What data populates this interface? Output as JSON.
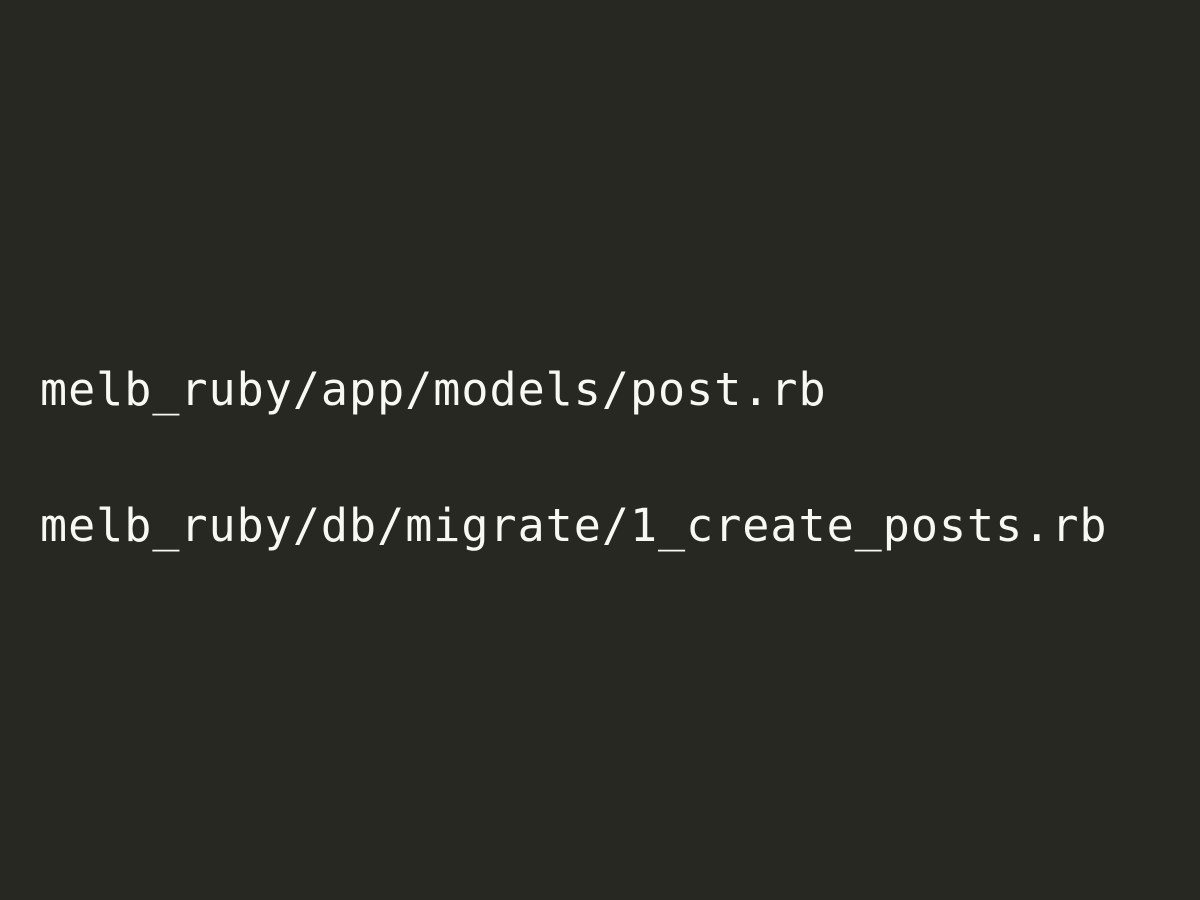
{
  "slide": {
    "background_color": "#272822",
    "text_color": "#f8f8f2",
    "paths": [
      "melb_ruby/app/models/post.rb",
      "melb_ruby/db/migrate/1_create_posts.rb"
    ]
  }
}
